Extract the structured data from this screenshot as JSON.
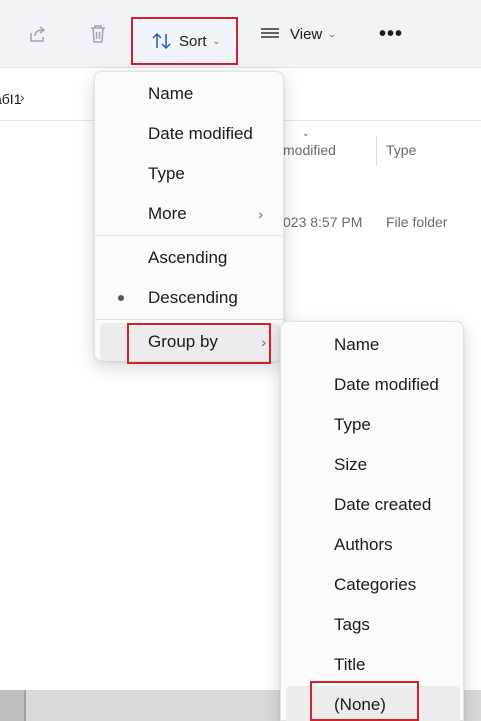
{
  "toolbar": {
    "share_icon": "share-icon",
    "delete_icon": "delete-icon",
    "sort_label": "Sort",
    "view_label": "View",
    "more_label": "•••"
  },
  "address": {
    "crumb": "абІ1",
    "separator": "›"
  },
  "columns": {
    "date_modified": "modified",
    "type": "Type"
  },
  "row": {
    "date": "023 8:57 PM",
    "type": "File folder"
  },
  "sort_menu": {
    "items": [
      {
        "label": "Name"
      },
      {
        "label": "Date modified"
      },
      {
        "label": "Type"
      },
      {
        "label": "More"
      }
    ],
    "order": [
      {
        "label": "Ascending"
      },
      {
        "label": "Descending",
        "selected": true
      }
    ],
    "group_by": "Group by"
  },
  "group_menu": {
    "items": [
      {
        "label": "Name"
      },
      {
        "label": "Date modified"
      },
      {
        "label": "Type"
      },
      {
        "label": "Size"
      },
      {
        "label": "Date created"
      },
      {
        "label": "Authors"
      },
      {
        "label": "Categories"
      },
      {
        "label": "Tags"
      },
      {
        "label": "Title"
      },
      {
        "label": "(None)"
      }
    ]
  },
  "colors": {
    "highlight": "#d4202a",
    "toolbar_bg": "#f0f4f9",
    "accent_icon": "#1a5fb4"
  }
}
